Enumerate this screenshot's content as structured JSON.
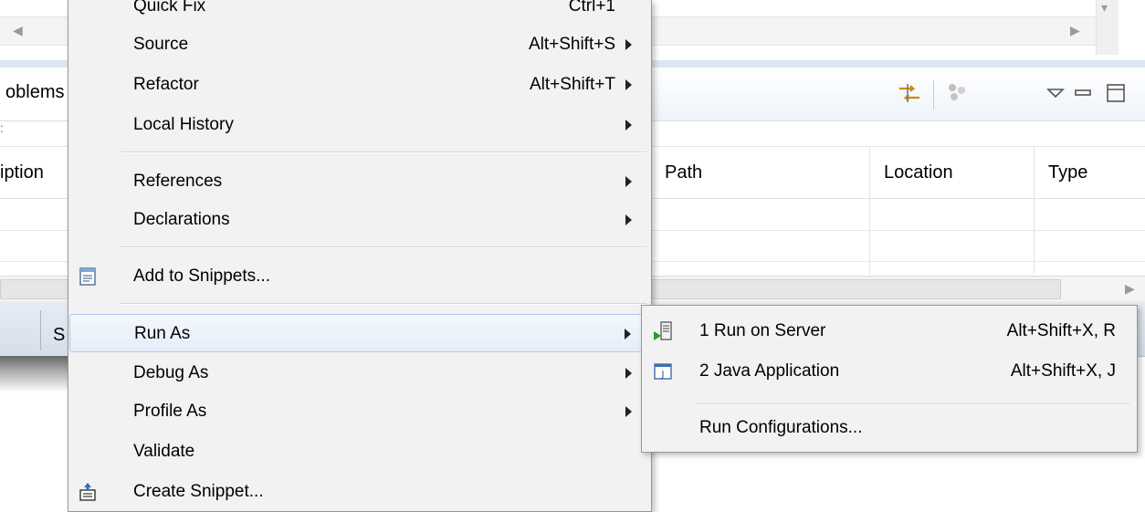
{
  "background": {
    "problems_tab_label": "oblems",
    "sub_link": ":",
    "columns": {
      "description": "iption",
      "path": "Path",
      "location": "Location",
      "type": "Type"
    },
    "status_item": "S"
  },
  "menu": {
    "items": [
      {
        "label": "Quick Fix",
        "accel": "Ctrl+1"
      },
      {
        "label": "Source",
        "accel": "Alt+Shift+S"
      },
      {
        "label": "Refactor",
        "accel": "Alt+Shift+T"
      },
      {
        "label": "Local History",
        "accel": ""
      },
      {
        "label": "References",
        "accel": ""
      },
      {
        "label": "Declarations",
        "accel": ""
      },
      {
        "label": "Add to Snippets...",
        "accel": ""
      },
      {
        "label": "Run As",
        "accel": ""
      },
      {
        "label": "Debug As",
        "accel": ""
      },
      {
        "label": "Profile As",
        "accel": ""
      },
      {
        "label": "Validate",
        "accel": ""
      },
      {
        "label": "Create Snippet...",
        "accel": ""
      }
    ]
  },
  "submenu": {
    "items": [
      {
        "label": "1 Run on Server",
        "accel": "Alt+Shift+X, R"
      },
      {
        "label": "2 Java Application",
        "accel": "Alt+Shift+X, J"
      },
      {
        "label": "Run Configurations...",
        "accel": ""
      }
    ]
  },
  "icons": {
    "snippet_add": "snippet-icon",
    "run_on_server": "server-run-icon",
    "java_app": "java-application-icon",
    "create_snippet": "create-snippet-icon"
  }
}
